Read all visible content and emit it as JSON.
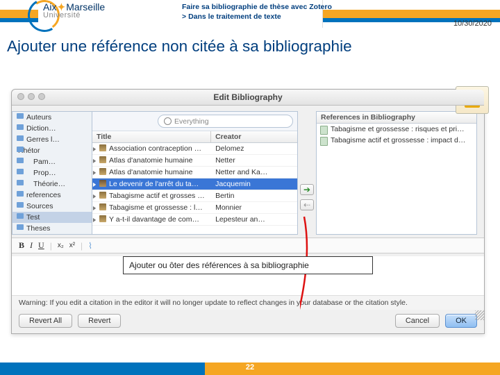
{
  "header": {
    "logo_main_a": "Aix",
    "logo_main_b": "Marseille",
    "logo_sub": "Université",
    "breadcrumb_l1": "Faire sa bibliographie de thèse avec Zotero",
    "breadcrumb_l2": "Dans le traitement de texte",
    "date": "10/30/2020"
  },
  "title": "Ajouter une référence non citée à sa bibliographie",
  "dialog": {
    "title": "Edit Bibliography",
    "search_placeholder": "Everything",
    "col_title": "Title",
    "col_creator": "Creator",
    "right_header": "References in Bibliography",
    "folders": [
      "Auteurs",
      "Diction…",
      "Gerres l…",
      "Rhétor",
      "Pam…",
      "Prop…",
      "Théorie…",
      "references",
      "Sources",
      "Test",
      "Theses"
    ],
    "rows": [
      {
        "title": "Association contraception …",
        "creator": "Delomez"
      },
      {
        "title": "Atlas d'anatomie humaine",
        "creator": "Netter"
      },
      {
        "title": "Atlas d'anatomie humaine",
        "creator": "Netter and Ka…"
      },
      {
        "title": "Le devenir de l'arrêt du ta…",
        "creator": "Jacquemin"
      },
      {
        "title": "Tabagisme actif et grosses …",
        "creator": "Bertin"
      },
      {
        "title": "Tabagisme et grossesse : l…",
        "creator": "Monnier"
      },
      {
        "title": "Y a-t-il davantage de com…",
        "creator": "Lepesteur an…"
      }
    ],
    "bibrefs": [
      "Tabagisme et grossesse : risques et pri…",
      "Tabagisme actif et grossesse : impact d…"
    ],
    "fmt": {
      "b": "B",
      "i": "I",
      "u": "U",
      "x1": "x₂",
      "x2": "x²"
    },
    "warning": "Warning: If you edit a citation in the editor it will no longer update to reflect changes in your database or the citation style.",
    "revert_all": "Revert All",
    "revert": "Revert",
    "cancel": "Cancel",
    "ok": "OK"
  },
  "annotation": "Ajouter ou ôter des références à sa bibliographie",
  "page_number": "22"
}
